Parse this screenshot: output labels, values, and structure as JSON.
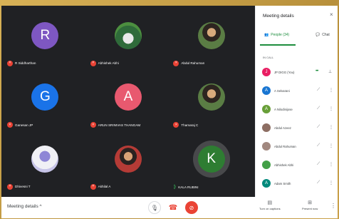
{
  "grid": [
    {
      "name": "R Siddharthan",
      "initial": "R",
      "avatar_color": "#7e57c2",
      "kind": "letter",
      "speaking": false
    },
    {
      "name": "Abhishek Abhi",
      "initial": "",
      "avatar_color": "",
      "kind": "photo car",
      "speaking": false
    },
    {
      "name": "Abdul Rahuman",
      "initial": "",
      "avatar_color": "",
      "kind": "photo man3",
      "speaking": false
    },
    {
      "name": "Ganesan JP",
      "initial": "G",
      "avatar_color": "#1a73e8",
      "kind": "letter",
      "speaking": false
    },
    {
      "name": "ARUN SRINIVAS THANGAM",
      "initial": "A",
      "avatar_color": "#e8596f",
      "kind": "letter",
      "speaking": false
    },
    {
      "name": "Thamaraj C",
      "initial": "",
      "avatar_color": "",
      "kind": "photo man3",
      "speaking": false
    },
    {
      "name": "Dhivesni T",
      "initial": "",
      "avatar_color": "",
      "kind": "photo girl",
      "speaking": false
    },
    {
      "name": "Akhilal A",
      "initial": "",
      "avatar_color": "",
      "kind": "photo man2",
      "speaking": false
    },
    {
      "name": "KALA RUBINI",
      "initial": "K",
      "avatar_color": "#2e7d32",
      "kind": "letter ring",
      "speaking": true
    }
  ],
  "bottom_bar": {
    "meeting_details": "Meeting details",
    "meeting_details_chevron": "^",
    "turn_on_captions": "Turn on captions",
    "present_now": "Present now"
  },
  "panel": {
    "title": "Meeting details",
    "close": "×",
    "tab_people": "People (34)",
    "tab_chat": "Chat",
    "section_label": "IN CALL",
    "participants": [
      {
        "name": "JP DIGG (You)",
        "initial": "J",
        "color": "#e91e63",
        "self": true
      },
      {
        "name": "A Selvarani",
        "initial": "A",
        "color": "#1976d2",
        "self": false
      },
      {
        "name": "A Nilodinijose",
        "initial": "A",
        "color": "#689f38",
        "self": false
      },
      {
        "name": "Abdul Azeez",
        "initial": "",
        "color": "#8d6e63",
        "self": false
      },
      {
        "name": "Abdul Rahuman",
        "initial": "",
        "color": "#a1887f",
        "self": false
      },
      {
        "name": "Abhishek Abhi",
        "initial": "",
        "color": "#43a047",
        "self": false
      },
      {
        "name": "Adam Smith",
        "initial": "A",
        "color": "#00897b",
        "self": false
      }
    ]
  },
  "colors": {
    "accent_green": "#1e8e3e",
    "mute_red": "#ea4335",
    "call_bg": "#202124"
  }
}
